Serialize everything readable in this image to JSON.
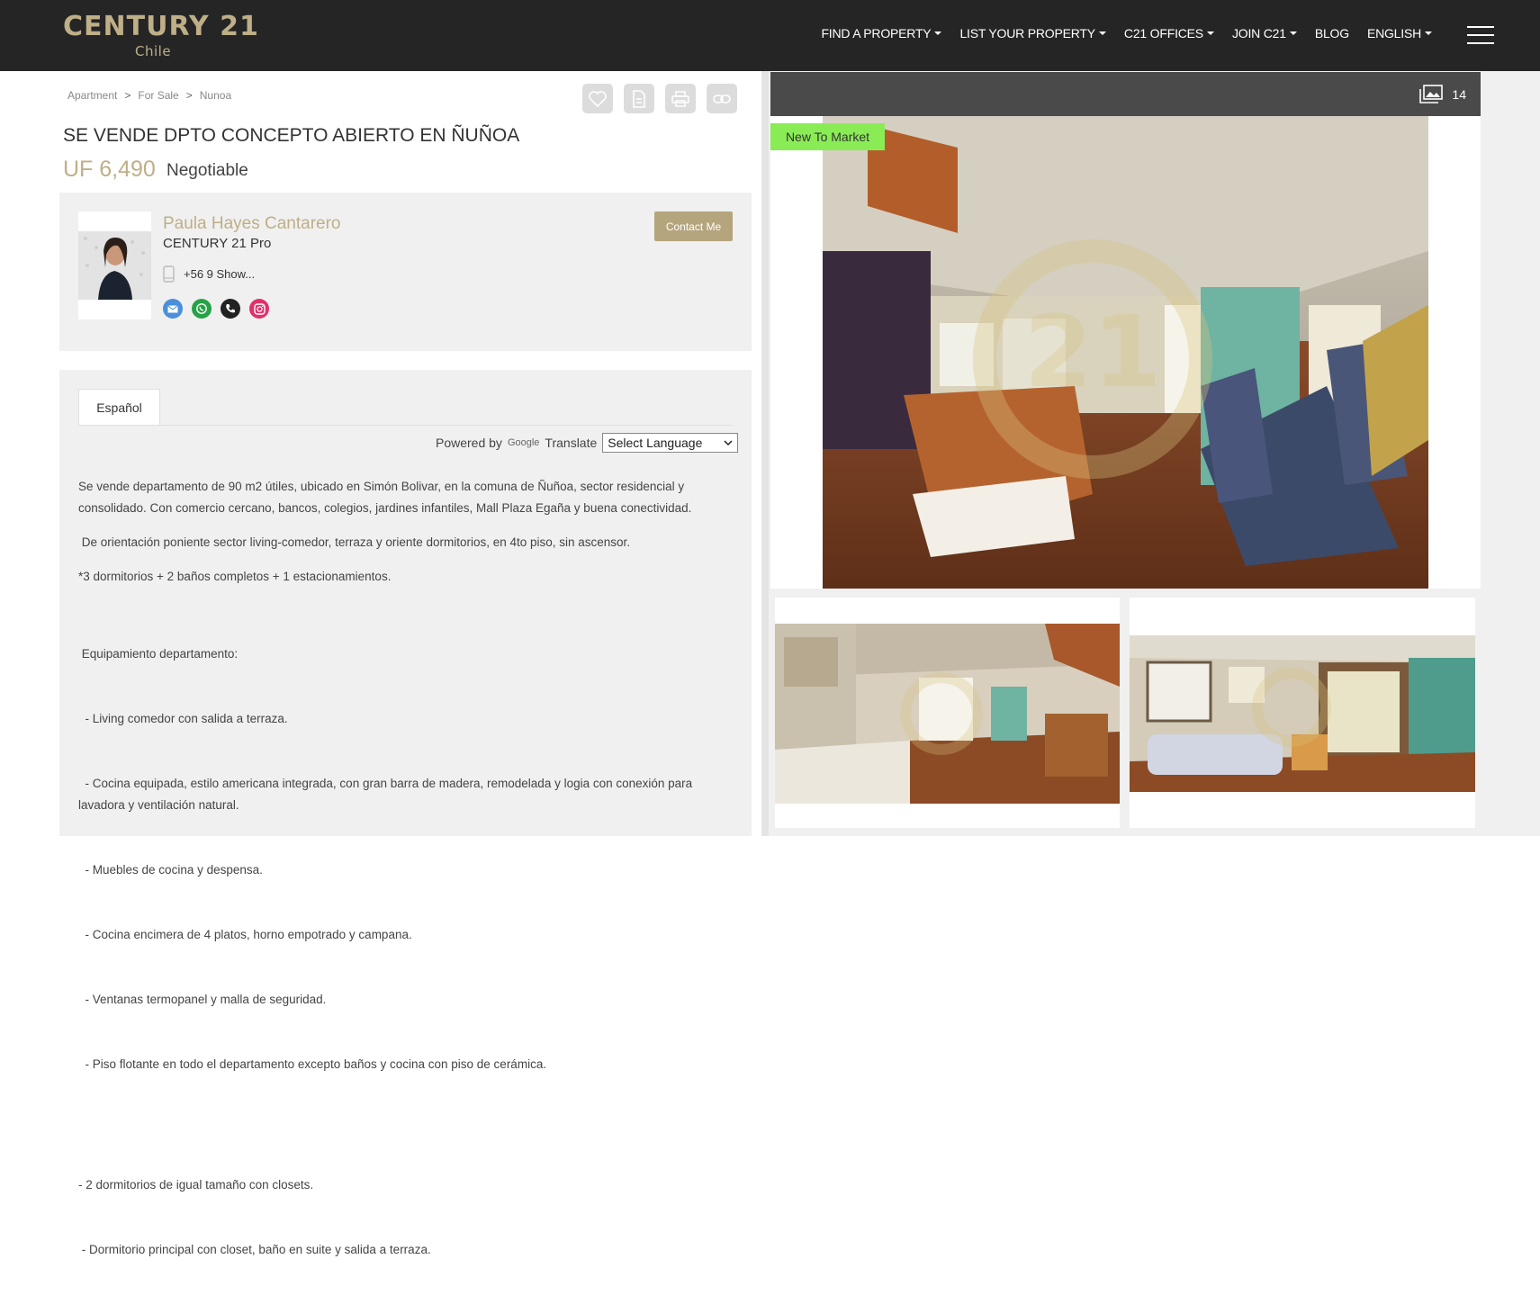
{
  "brand": {
    "name": "CENTURY 21",
    "region": "Chile"
  },
  "nav": {
    "items": [
      {
        "label": "FIND A PROPERTY",
        "dropdown": true
      },
      {
        "label": "LIST YOUR PROPERTY",
        "dropdown": true
      },
      {
        "label": "C21 OFFICES",
        "dropdown": true
      },
      {
        "label": "JOIN C21",
        "dropdown": true
      },
      {
        "label": "BLOG",
        "dropdown": false
      },
      {
        "label": "ENGLISH",
        "dropdown": true
      }
    ],
    "menu_icon": "hamburger-icon"
  },
  "breadcrumb": {
    "items": [
      "Apartment",
      "For Sale",
      "Nunoa"
    ],
    "separator": ">"
  },
  "actions": [
    "heart-icon",
    "document-icon",
    "print-icon",
    "link-icon"
  ],
  "listing": {
    "title": "SE VENDE DPTO CONCEPTO ABIERTO EN ÑUÑOA",
    "price": "UF 6,490",
    "price_note": "Negotiable",
    "badge": "New To Market",
    "photo_count": "14"
  },
  "agent": {
    "name": "Paula Hayes Cantarero",
    "company": "CENTURY 21 Pro",
    "phone": "+56 9 Show...",
    "contact_label": "Contact Me",
    "socials": [
      "email-icon",
      "whatsapp-icon",
      "phone-icon",
      "instagram-icon"
    ]
  },
  "description": {
    "tab": "Español",
    "powered_by": "Powered by",
    "google": "Google",
    "translate": "Translate",
    "select_placeholder": "Select Language",
    "paragraphs": [
      "Se vende departamento de 90 m2 útiles, ubicado en Simón Bolivar, en la comuna de Ñuñoa, sector residencial y consolidado. Con comercio cercano, bancos, colegios, jardines infantiles, Mall Plaza Egaña y buena conectividad.",
      " De orientación poniente sector living-comedor, terraza y oriente dormitorios, en 4to piso, sin ascensor.",
      "*3 dormitorios + 2 baños completos + 1 estacionamientos.",
      " Equipamiento departamento:",
      "  - Living comedor con salida a terraza.",
      "  - Cocina equipada, estilo americana integrada, con gran barra de madera, remodelada y logia con conexión para lavadora y ventilación natural.",
      "  - Muebles de cocina y despensa.",
      "  - Cocina encimera de 4 platos, horno empotrado y campana.",
      "  - Ventanas termopanel y malla de seguridad.",
      "  - Piso flotante en todo el departamento excepto baños y cocina con piso de cerámica.",
      "- 2 dormitorios de igual tamaño con closets.",
      " - Dormitorio principal con closet, baño en suite y salida a terraza."
    ]
  },
  "colors": {
    "header_bg": "#252526",
    "gold": "#beaf87",
    "badge_green": "#89ec55",
    "panel_bg": "#f0f0f0"
  }
}
